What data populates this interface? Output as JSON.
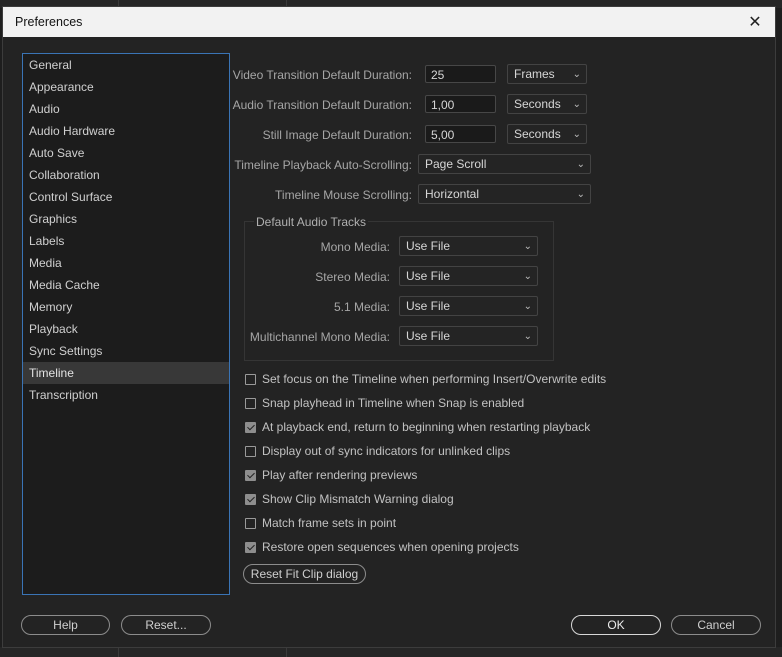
{
  "window": {
    "title": "Preferences"
  },
  "sidebar": {
    "selected": "Timeline",
    "items": [
      "General",
      "Appearance",
      "Audio",
      "Audio Hardware",
      "Auto Save",
      "Collaboration",
      "Control Surface",
      "Graphics",
      "Labels",
      "Media",
      "Media Cache",
      "Memory",
      "Playback",
      "Sync Settings",
      "Timeline",
      "Transcription"
    ]
  },
  "settings": {
    "video_transition": {
      "label": "Video Transition Default Duration:",
      "value": "25",
      "unit": "Frames"
    },
    "audio_transition": {
      "label": "Audio Transition Default Duration:",
      "value": "1,00",
      "unit": "Seconds"
    },
    "still_image": {
      "label": "Still Image Default Duration:",
      "value": "5,00",
      "unit": "Seconds"
    },
    "playback_autoscroll": {
      "label": "Timeline Playback Auto-Scrolling:",
      "value": "Page Scroll"
    },
    "mouse_scroll": {
      "label": "Timeline Mouse Scrolling:",
      "value": "Horizontal"
    }
  },
  "audio_tracks": {
    "title": "Default Audio Tracks",
    "mono": {
      "label": "Mono Media:",
      "value": "Use File"
    },
    "stereo": {
      "label": "Stereo Media:",
      "value": "Use File"
    },
    "five_one": {
      "label": "5.1 Media:",
      "value": "Use File"
    },
    "multichannel": {
      "label": "Multichannel Mono Media:",
      "value": "Use File"
    }
  },
  "checkboxes": [
    {
      "label": "Set focus on the Timeline when performing Insert/Overwrite edits",
      "checked": false
    },
    {
      "label": "Snap playhead in Timeline when Snap is enabled",
      "checked": false
    },
    {
      "label": "At playback end, return to beginning when restarting playback",
      "checked": true
    },
    {
      "label": "Display out of sync indicators for unlinked clips",
      "checked": false
    },
    {
      "label": "Play after rendering previews",
      "checked": true
    },
    {
      "label": "Show Clip Mismatch Warning dialog",
      "checked": true
    },
    {
      "label": "Match frame sets in point",
      "checked": false
    },
    {
      "label": "Restore open sequences when opening projects",
      "checked": true
    }
  ],
  "buttons": {
    "reset_fit": "Reset Fit Clip dialog",
    "help": "Help",
    "reset": "Reset...",
    "ok": "OK",
    "cancel": "Cancel"
  },
  "icons": {
    "close": "close-icon",
    "chevron": "chevron-down-icon",
    "check": "check-icon"
  },
  "colors": {
    "sidebar_border": "#3a74b5",
    "dialog_bg": "#232323",
    "titlebar_bg": "#f2f2f2"
  }
}
